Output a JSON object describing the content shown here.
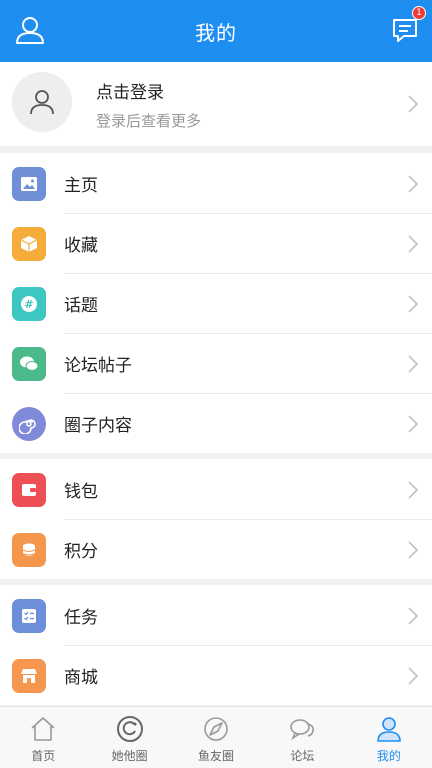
{
  "header": {
    "title": "我的",
    "badge_count": "1"
  },
  "login": {
    "title": "点击登录",
    "subtitle": "登录后查看更多"
  },
  "groups": [
    [
      {
        "label": "主页",
        "icon": "image-icon",
        "color": "#6f8fd6"
      },
      {
        "label": "收藏",
        "icon": "box-icon",
        "color": "#f6ac3b"
      },
      {
        "label": "话题",
        "icon": "hash-icon",
        "color": "#3ec6c3"
      },
      {
        "label": "论坛帖子",
        "icon": "chat-icon",
        "color": "#4cb98a"
      },
      {
        "label": "圈子内容",
        "icon": "spiral-icon",
        "color": "#7f8bd9"
      }
    ],
    [
      {
        "label": "钱包",
        "icon": "wallet-icon",
        "color": "#ee4f55"
      },
      {
        "label": "积分",
        "icon": "coins-icon",
        "color": "#f5964d"
      }
    ],
    [
      {
        "label": "任务",
        "icon": "checklist-icon",
        "color": "#6d8ed8"
      },
      {
        "label": "商城",
        "icon": "store-icon",
        "color": "#f7964e"
      }
    ]
  ],
  "tabs": [
    {
      "label": "首页",
      "icon": "home-icon",
      "active": false
    },
    {
      "label": "她他圈",
      "icon": "camera-circle-icon",
      "active": false
    },
    {
      "label": "鱼友圈",
      "icon": "compass-icon",
      "active": false
    },
    {
      "label": "论坛",
      "icon": "chat-bubbles-icon",
      "active": false
    },
    {
      "label": "我的",
      "icon": "person-icon",
      "active": true
    }
  ],
  "colors": {
    "primary": "#1f8ef1",
    "badge": "#f33a3a"
  }
}
